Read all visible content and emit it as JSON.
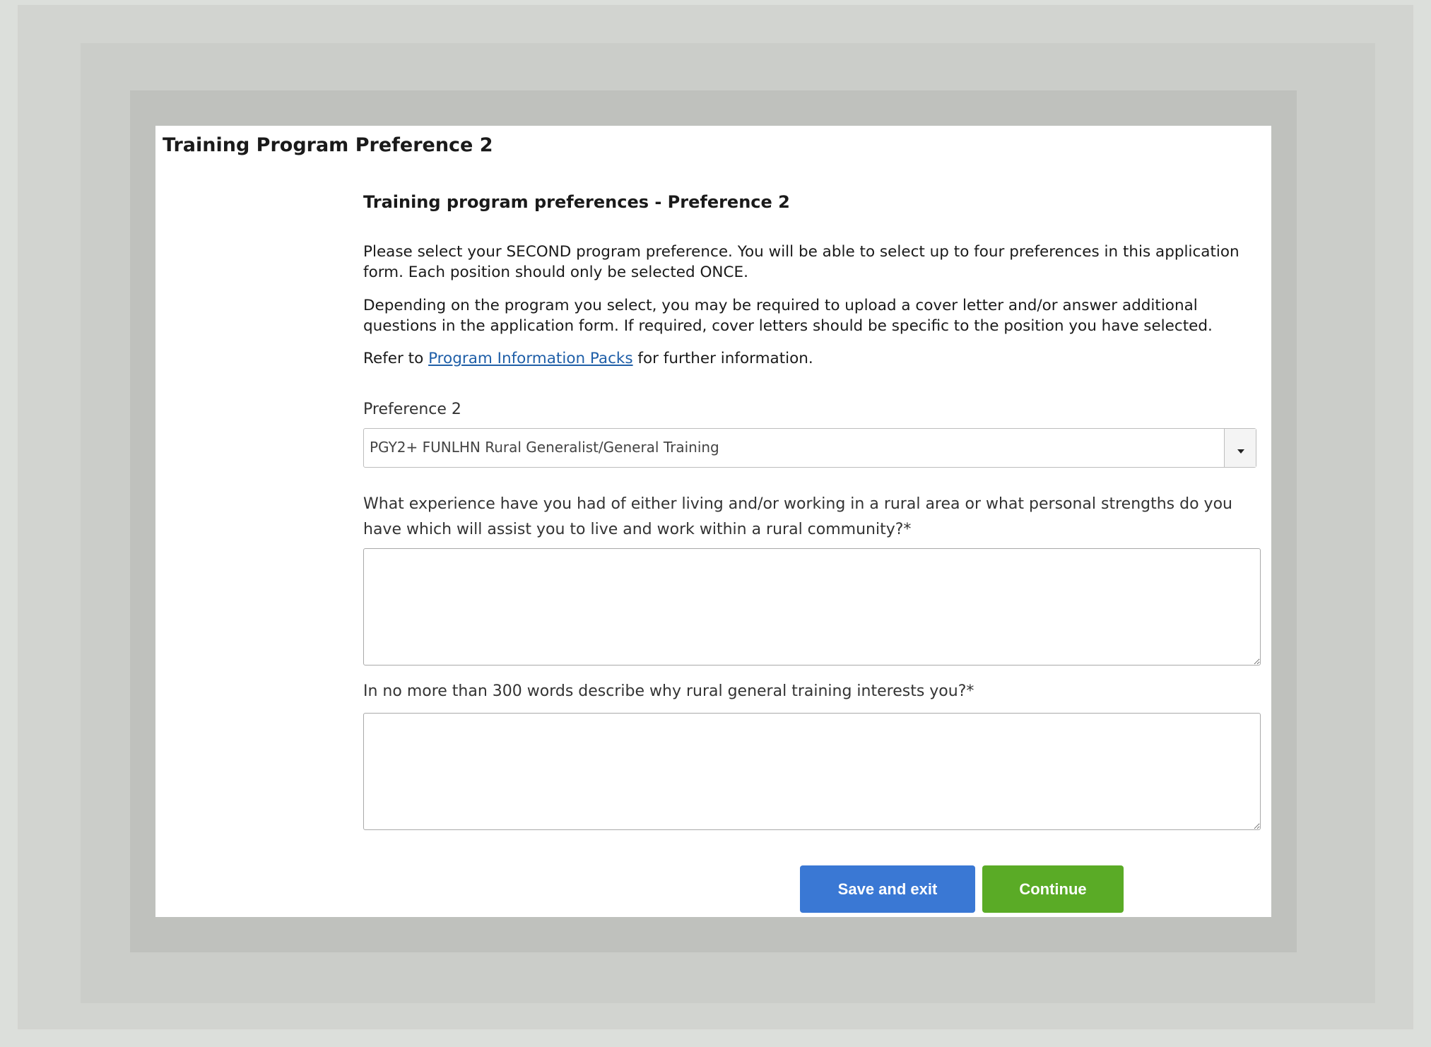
{
  "page": {
    "title": "Training Program Preference 2"
  },
  "section": {
    "heading": "Training program preferences - Preference 2",
    "paragraph1": "Please select your SECOND program preference. You will be able to select up to four preferences in this application form. Each position should only be selected ONCE.",
    "paragraph2": "Depending on the program you select, you may be required to upload a cover letter and/or answer additional questions in the application form. If required, cover letters should be specific to the position you have selected.",
    "refer_prefix": "Refer to ",
    "refer_link": "Program Information Packs",
    "refer_suffix": " for further information."
  },
  "preference": {
    "label": "Preference 2",
    "selected_value": "PGY2+ FUNLHN Rural Generalist/General Training",
    "icon": "chevron-down-icon"
  },
  "questions": {
    "q1_label": "What experience have you had of either living and/or working in a rural area or what personal strengths do you have which will assist you to live and work within a rural community?*",
    "q1_value": "",
    "q2_label": "In no more than 300 words describe why rural general training interests you?*",
    "q2_value": ""
  },
  "buttons": {
    "save_label": "Save and exit",
    "continue_label": "Continue"
  },
  "colors": {
    "save_button": "#3a78d4",
    "continue_button": "#5aab26",
    "link": "#1f5fa8"
  }
}
